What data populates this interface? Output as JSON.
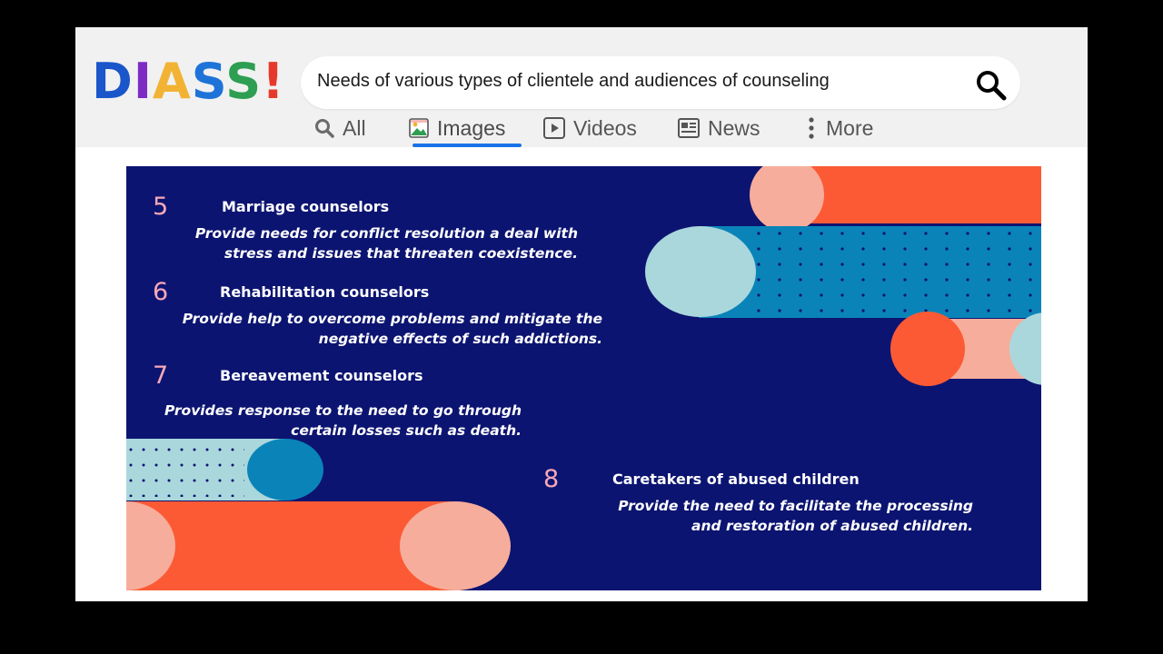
{
  "logo": {
    "text_parts": [
      "D",
      "I",
      "A",
      "S",
      "S",
      "!"
    ],
    "colors": [
      "#1a56c9",
      "#7e2bc4",
      "#f2b233",
      "#1e73d8",
      "#2e9e52",
      "#e53a2b"
    ]
  },
  "search": {
    "query": "Needs of various types of clientele and audiences of counseling"
  },
  "nav": {
    "items": [
      {
        "label": "All",
        "icon": "search-icon"
      },
      {
        "label": "Images",
        "icon": "image-icon",
        "active": true
      },
      {
        "label": "Videos",
        "icon": "play-icon"
      },
      {
        "label": "News",
        "icon": "news-icon"
      },
      {
        "label": "More",
        "icon": "more-vertical-icon"
      }
    ]
  },
  "slide": {
    "items": [
      {
        "number": "5",
        "title": "Marriage counselors",
        "desc": [
          "Provide needs for conflict resolution a deal with",
          "stress and issues that threaten coexistence."
        ]
      },
      {
        "number": "6",
        "title": "Rehabilitation counselors",
        "desc": [
          "Provide help to overcome problems and mitigate the",
          "negative effects of such addictions."
        ]
      },
      {
        "number": "7",
        "title": "Bereavement counselors",
        "desc": [
          "Provides response to the need to go through",
          "certain losses such as death."
        ]
      },
      {
        "number": "8",
        "title": "Caretakers of abused children",
        "desc": [
          "Provide the need to facilitate the processing",
          "and restoration of abused children."
        ]
      }
    ],
    "colors": {
      "background": "#0c1471",
      "orange": "#fc5a35",
      "peach": "#f7ad9b",
      "teal": "#0a84b8",
      "mint": "#aad7dc",
      "number": "#f7a8b8"
    }
  }
}
